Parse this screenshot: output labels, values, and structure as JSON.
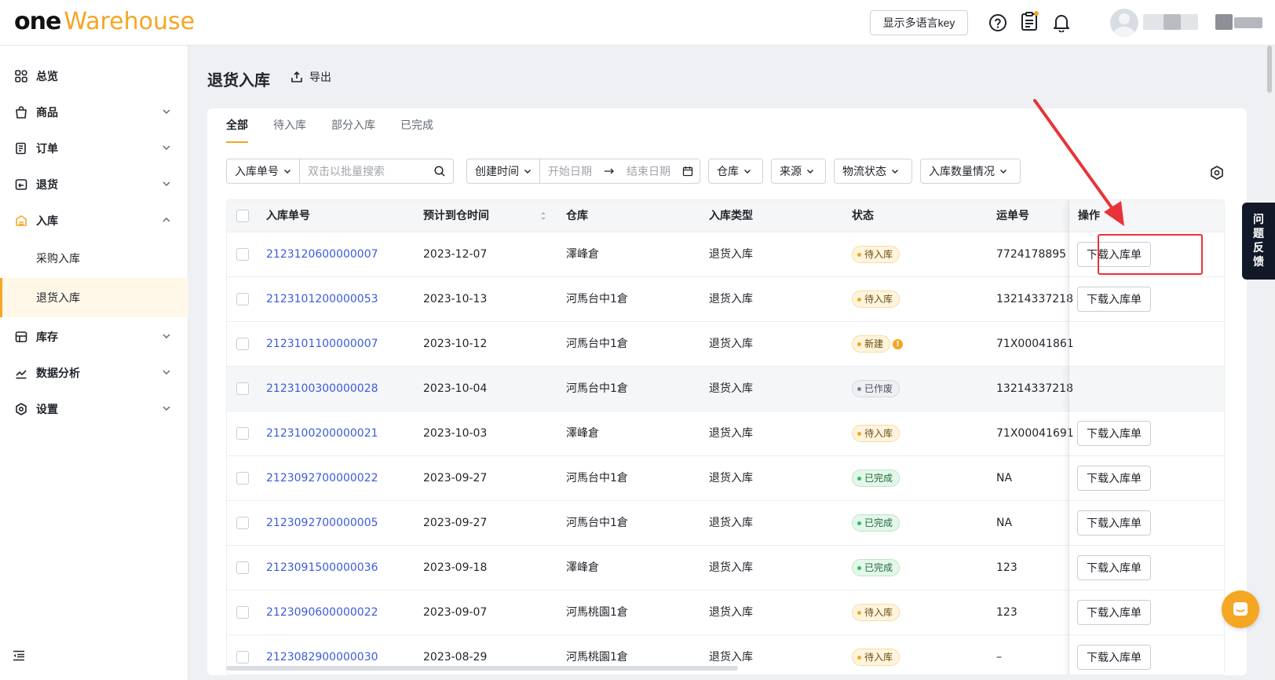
{
  "app": {
    "logo_one": "one",
    "logo_warehouse": "Warehouse",
    "lang_button": "显示多语言key"
  },
  "sidebar": {
    "items": [
      {
        "label": "总览",
        "icon": "dashboard-icon",
        "expandable": false
      },
      {
        "label": "商品",
        "icon": "bag-icon",
        "expandable": true
      },
      {
        "label": "订单",
        "icon": "order-icon",
        "expandable": true
      },
      {
        "label": "退货",
        "icon": "return-icon",
        "expandable": true
      },
      {
        "label": "入库",
        "icon": "inbound-icon",
        "expandable": true,
        "expanded": true
      },
      {
        "label": "库存",
        "icon": "inventory-icon",
        "expandable": true
      },
      {
        "label": "数据分析",
        "icon": "analytics-icon",
        "expandable": true
      },
      {
        "label": "设置",
        "icon": "settings-icon",
        "expandable": true
      }
    ],
    "sub_items": [
      {
        "label": "采购入库"
      },
      {
        "label": "退货入库",
        "active": true
      }
    ]
  },
  "page": {
    "title": "退货入库",
    "export_label": "导出"
  },
  "tabs": [
    {
      "label": "全部",
      "active": true
    },
    {
      "label": "待入库"
    },
    {
      "label": "部分入库"
    },
    {
      "label": "已完成"
    }
  ],
  "filters": {
    "search_field": "入库单号",
    "search_placeholder": "双击以批量搜索",
    "time_field": "创建时间",
    "start_placeholder": "开始日期",
    "end_placeholder": "结束日期",
    "warehouse": "仓库",
    "source": "来源",
    "logistics": "物流状态",
    "quantity": "入库数量情况"
  },
  "table": {
    "columns": [
      "入库单号",
      "预计到仓时间",
      "仓库",
      "入库类型",
      "状态",
      "运单号",
      "操作"
    ],
    "rows": [
      {
        "id": "2123120600000007",
        "eta": "2023-12-07",
        "warehouse": "澤峰倉",
        "type": "退货入库",
        "status": "待入库",
        "status_kind": "wait",
        "tracking": "7724178895",
        "action": "下载入库单"
      },
      {
        "id": "2123101200000053",
        "eta": "2023-10-13",
        "warehouse": "河馬台中1倉",
        "type": "退货入库",
        "status": "待入库",
        "status_kind": "wait",
        "tracking": "13214337218",
        "action": "下载入库单"
      },
      {
        "id": "2123101100000007",
        "eta": "2023-10-12",
        "warehouse": "河馬台中1倉",
        "type": "退货入库",
        "status": "新建",
        "status_kind": "new",
        "tracking": "71X00041861",
        "action": ""
      },
      {
        "id": "2123100300000028",
        "eta": "2023-10-04",
        "warehouse": "河馬台中1倉",
        "type": "退货入库",
        "status": "已作废",
        "status_kind": "void",
        "tracking": "13214337218",
        "action": ""
      },
      {
        "id": "2123100200000021",
        "eta": "2023-10-03",
        "warehouse": "澤峰倉",
        "type": "退货入库",
        "status": "待入库",
        "status_kind": "wait",
        "tracking": "71X00041691",
        "action": "下载入库单"
      },
      {
        "id": "2123092700000022",
        "eta": "2023-09-27",
        "warehouse": "河馬台中1倉",
        "type": "退货入库",
        "status": "已完成",
        "status_kind": "done",
        "tracking": "NA",
        "action": "下载入库单"
      },
      {
        "id": "2123092700000005",
        "eta": "2023-09-27",
        "warehouse": "河馬台中1倉",
        "type": "退货入库",
        "status": "已完成",
        "status_kind": "done",
        "tracking": "NA",
        "action": "下载入库单"
      },
      {
        "id": "2123091500000036",
        "eta": "2023-09-18",
        "warehouse": "澤峰倉",
        "type": "退货入库",
        "status": "已完成",
        "status_kind": "done",
        "tracking": "123",
        "action": "下载入库单"
      },
      {
        "id": "2123090600000022",
        "eta": "2023-09-07",
        "warehouse": "河馬桃園1倉",
        "type": "退货入库",
        "status": "待入库",
        "status_kind": "wait",
        "tracking": "123",
        "action": "下载入库单"
      },
      {
        "id": "2123082900000030",
        "eta": "2023-08-29",
        "warehouse": "河馬桃園1倉",
        "type": "退货入库",
        "status": "待入库",
        "status_kind": "wait",
        "tracking": "–",
        "action": "下载入库单"
      }
    ]
  },
  "feedback_label": "问题反馈",
  "colors": {
    "accent": "#f5a623",
    "link": "#3b5bdb",
    "annotation": "#e8333a"
  }
}
